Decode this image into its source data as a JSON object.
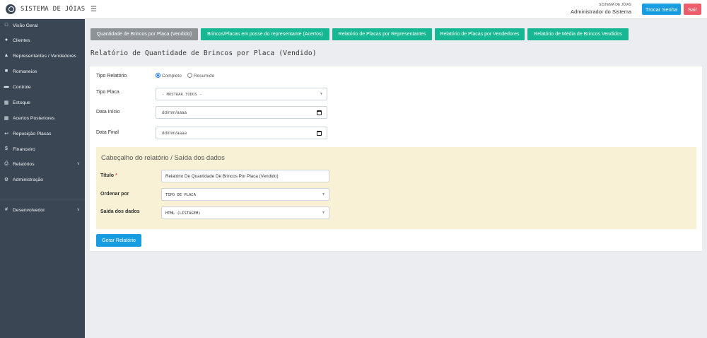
{
  "header": {
    "brand": "SISTEMA DE JÓIAS",
    "system_name": "SISTEMA DE JÓIAS",
    "user_name": "Administrador do Sistema",
    "change_password_label": "Trocar Senha",
    "logout_label": "Sair"
  },
  "sidebar": {
    "items": [
      {
        "label": "Visão Geral",
        "icon": "monitor-icon"
      },
      {
        "label": "Clientes",
        "icon": "users-icon"
      },
      {
        "label": "Representantes / Vendedores",
        "icon": "user-tie-icon"
      },
      {
        "label": "Romaneios",
        "icon": "briefcase-icon"
      },
      {
        "label": "Controle",
        "icon": "id-card-icon"
      },
      {
        "label": "Estoque",
        "icon": "grid-icon"
      },
      {
        "label": "Acertos Posteriores",
        "icon": "calendar-icon"
      },
      {
        "label": "Reposição Placas",
        "icon": "reply-icon"
      },
      {
        "label": "Financeiro",
        "icon": "dollar-icon"
      },
      {
        "label": "Relatórios",
        "icon": "printer-icon"
      },
      {
        "label": "Administração",
        "icon": "gear-icon"
      },
      {
        "label": "Desenvolvedor",
        "icon": "hash-icon"
      }
    ]
  },
  "tabs": [
    {
      "label": "Quantidade de Brincos por Placa (Vendido)",
      "active": true
    },
    {
      "label": "Brincos/Placas em posse do representante (Acertos)",
      "active": false
    },
    {
      "label": "Relatório de Placas por Representantes",
      "active": false
    },
    {
      "label": "Relatório de Placas por Vendedores",
      "active": false
    },
    {
      "label": "Relatório de Média de Brincos Vendidos",
      "active": false
    }
  ],
  "page_title": "Relatório de Quantidade de Brincos por Placa (Vendido)",
  "form": {
    "tipo_relatorio": {
      "label": "Tipo Relatório",
      "options": [
        "Completo",
        "Resumido"
      ],
      "selected": "Completo"
    },
    "tipo_placa": {
      "label": "Tipo Placa",
      "value": "- MOSTRAR TODOS -"
    },
    "data_inicio": {
      "label": "Data Início",
      "value": "dd/mm/aaaa"
    },
    "data_final": {
      "label": "Data Final",
      "value": "dd/mm/aaaa"
    }
  },
  "report_header": {
    "title": "Cabeçalho do relatório / Saída dos dados",
    "titulo_label": "Título",
    "required_mark": "*",
    "titulo_value": "Relatório De Quantidade De Brincos Por Placa (Vendido)",
    "ordenar_label": "Ordenar por",
    "ordenar_value": "TIPO DE PLACA",
    "saida_label": "Saída dos dados",
    "saida_value": "HTML (LISTAGEM)"
  },
  "generate_label": "Gerar Relatório",
  "colors": {
    "sidebar_bg": "#3a4654",
    "tab_active": "#8d9296",
    "tab_green": "#17b793",
    "primary": "#1a9de0",
    "danger": "#ef5c6a",
    "header_box_bg": "#f8f1d5"
  }
}
